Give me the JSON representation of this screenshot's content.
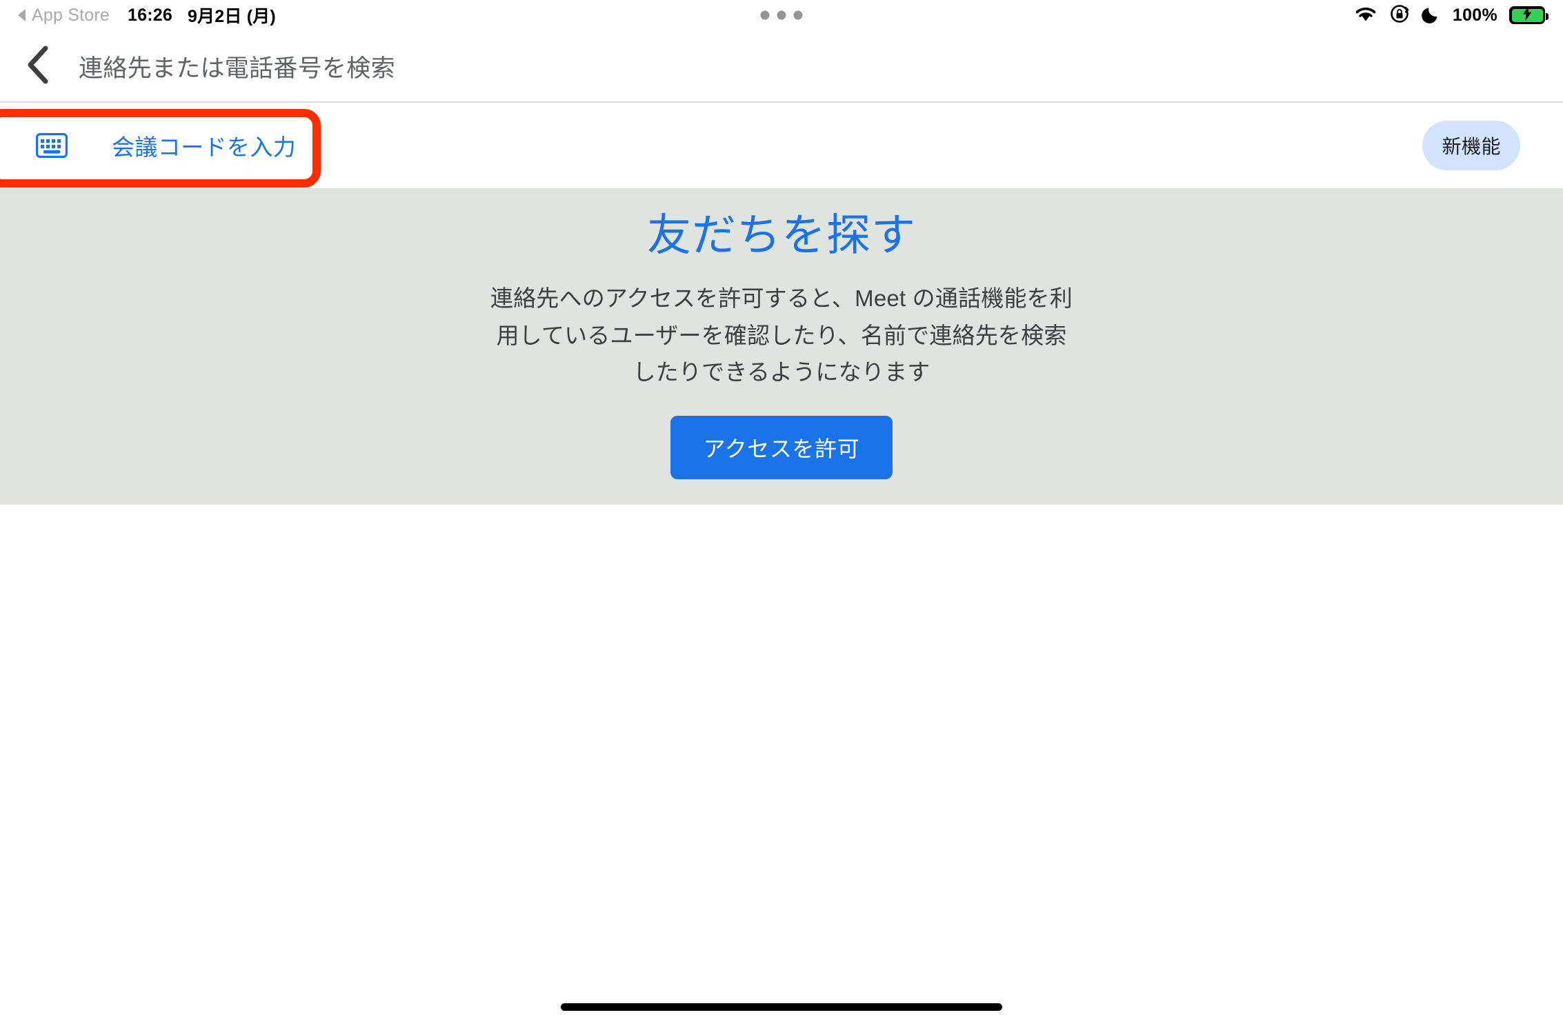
{
  "status_bar": {
    "back_app_label": "App Store",
    "back_arrow_icon": "triangle-left-icon",
    "time": "16:26",
    "date": "9月2日 (月)",
    "multitask_dots_icon": "three-dots-icon",
    "wifi_icon": "wifi-icon",
    "rotation_lock_icon": "rotation-lock-icon",
    "do_not_disturb_icon": "moon-icon",
    "battery_percent": "100%",
    "battery_icon": "battery-charging-icon",
    "battery_fill_color": "#33D158"
  },
  "navbar": {
    "back_icon": "chevron-left-icon",
    "search_placeholder": "連絡先または電話番号を検索"
  },
  "meeting_code_row": {
    "keyboard_icon": "keyboard-icon",
    "label": "会議コードを入力",
    "label_color": "#1a73e8",
    "new_badge": "新機能",
    "badge_bg_color": "#d2e3fc"
  },
  "annotation": {
    "shape": "rounded-rectangle-highlight",
    "color": "#FF2D00"
  },
  "promo": {
    "title": "友だちを探す",
    "title_color": "#1a73e8",
    "body": "連絡先へのアクセスを許可すると、Meet の通話機能を利用しているユーザーを確認したり、名前で連絡先を検索したりできるようになります",
    "button_label": "アクセスを許可",
    "button_color": "#1a73e8",
    "panel_bg_color": "#e1e3e0"
  },
  "home_indicator": {
    "label": "home-indicator"
  }
}
